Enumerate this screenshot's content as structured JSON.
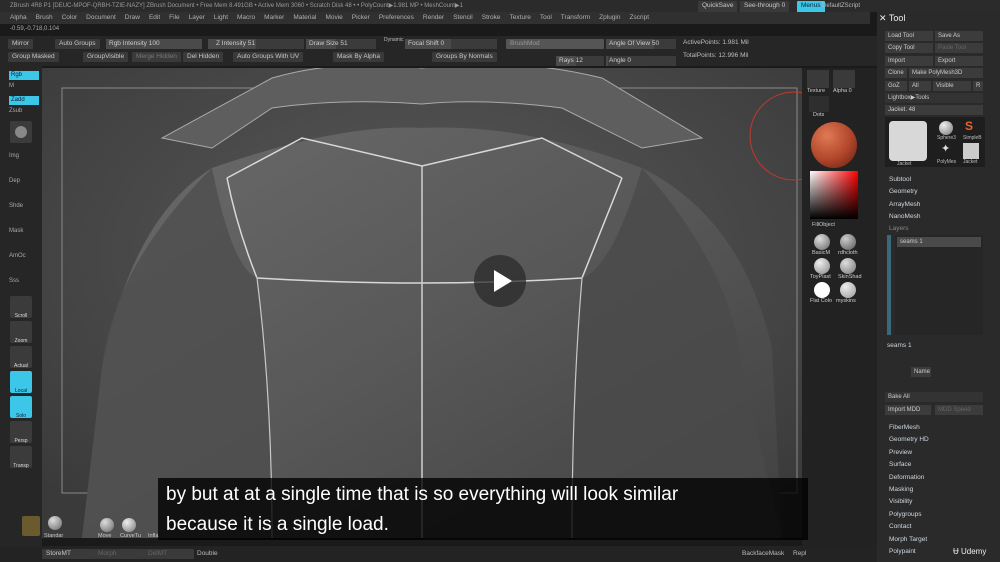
{
  "window": {
    "title": "ZBrush 4R8 P1 [DEUC-MPOF-QRBH-TZIE-NAZY]   ZBrush Document      • Free Mem 8.491GB • Active Mem 3060 • Scratch Disk 48 •    • PolyCount▶1.981 MP   • MeshCount▶1",
    "quicksave": "QuickSave",
    "seethrough": "See-through  0",
    "menus_btn": "Menus",
    "default_script": "DefaultZScript"
  },
  "menubar": [
    "Alpha",
    "Brush",
    "Color",
    "Document",
    "Draw",
    "Edit",
    "File",
    "Layer",
    "Light",
    "Macro",
    "Marker",
    "Material",
    "Movie",
    "Picker",
    "Preferences",
    "Render",
    "Stencil",
    "Stroke",
    "Texture",
    "Tool",
    "Transform",
    "Zplugin",
    "Zscript"
  ],
  "coords": "-0.59,-0.718,0.104",
  "topshelf": {
    "mirror": "Mirror",
    "auto_groups": "Auto Groups",
    "rgb_intensity": "Rgb Intensity 100",
    "z_intensity": "Z Intensity 51",
    "draw_size": "Draw Size 51",
    "dynamic": "Dynamic",
    "focal_shift": "Focal Shift 0",
    "brush_mod": "BrushMod",
    "angle_of_view": "Angle Of View 50",
    "active_points": "ActivePoints: 1.981 Mil",
    "group_masked": "Group Masked",
    "group_visible": "GroupVisible",
    "del_hidden": "Del Hidden",
    "auto_groups_uv": "Auto Groups With UV",
    "mask_by_alpha": "Mask By Alpha",
    "groups_by_normals": "Groups By Normals",
    "rays": "Rays 12",
    "angle": "Angle 0",
    "total_points": "TotalPoints: 12.996 Mil",
    "merge_hidden": "Merge Hidden"
  },
  "leftshelf": {
    "rgb": "Rgb",
    "m": "M",
    "zadd": "Zadd",
    "zsub": "Zsub",
    "img": "Img",
    "dep": "Dep",
    "shde": "Shde",
    "mask": "Mask",
    "amboc": "AmOc",
    "sss": "Sss",
    "scroll": "Scroll",
    "zoom": "Zoom",
    "actual": "Actual",
    "local": "Local",
    "solo": "Solo",
    "persp": "Persp",
    "transp": "Transp"
  },
  "rightdock": {
    "texture": "Texture",
    "alpha": "Alpha 0",
    "dots": "Dots",
    "fill_object": "FillObject",
    "materials": [
      "BasicM",
      "rdhcloth",
      "ToyPlast",
      "SkinShad",
      "Flat Colo",
      "myskins"
    ]
  },
  "toolpanel": {
    "header": "Tool",
    "load_tool": "Load Tool",
    "save_as": "Save As",
    "copy_tool": "Copy Tool",
    "paste_tool": "Paste Tool",
    "import": "Import",
    "export": "Export",
    "clone": "Clone",
    "make_polymesh": "Make PolyMesh3D",
    "goz": "GoZ",
    "all": "All",
    "visible": "Visible",
    "r": "R",
    "lightbox": "Lightbox▶Tools",
    "jacket": "Jacket. 48",
    "thumbs": [
      "Jacket",
      "Sphere3",
      "SimpleB",
      "PolyMes",
      "Jacket"
    ],
    "sections": [
      "Subtool",
      "Geometry",
      "ArrayMesh",
      "NanoMesh",
      "Layers"
    ],
    "layer_name": "seams 1",
    "layer_name2": "seams 1",
    "name_btn": "Name",
    "bake_all": "Bake All",
    "import_mdd": "Import MDD",
    "mdd_speed": "MDD Speed",
    "lower_sections": [
      "FiberMesh",
      "Geometry HD",
      "Preview",
      "Surface",
      "Deformation",
      "Masking",
      "Visibility",
      "Polygroups",
      "Contact",
      "Morph Target",
      "Polypaint"
    ]
  },
  "subtitle": {
    "line1": "by but at at a single time that is so everything will look similar",
    "line2": "because it is a single load."
  },
  "bottom": {
    "brushes": [
      "Standar",
      "Move",
      "CurveTu",
      "Infla"
    ],
    "storeMT": "StoreMT",
    "morph": "Morph",
    "delmt": "DelMT",
    "double": "Double",
    "backface": "BackfaceMask",
    "repl": "Repl",
    "udemy": "Udemy"
  },
  "colors": {
    "accent": "#3cc6e8",
    "material": "#b0452a"
  }
}
